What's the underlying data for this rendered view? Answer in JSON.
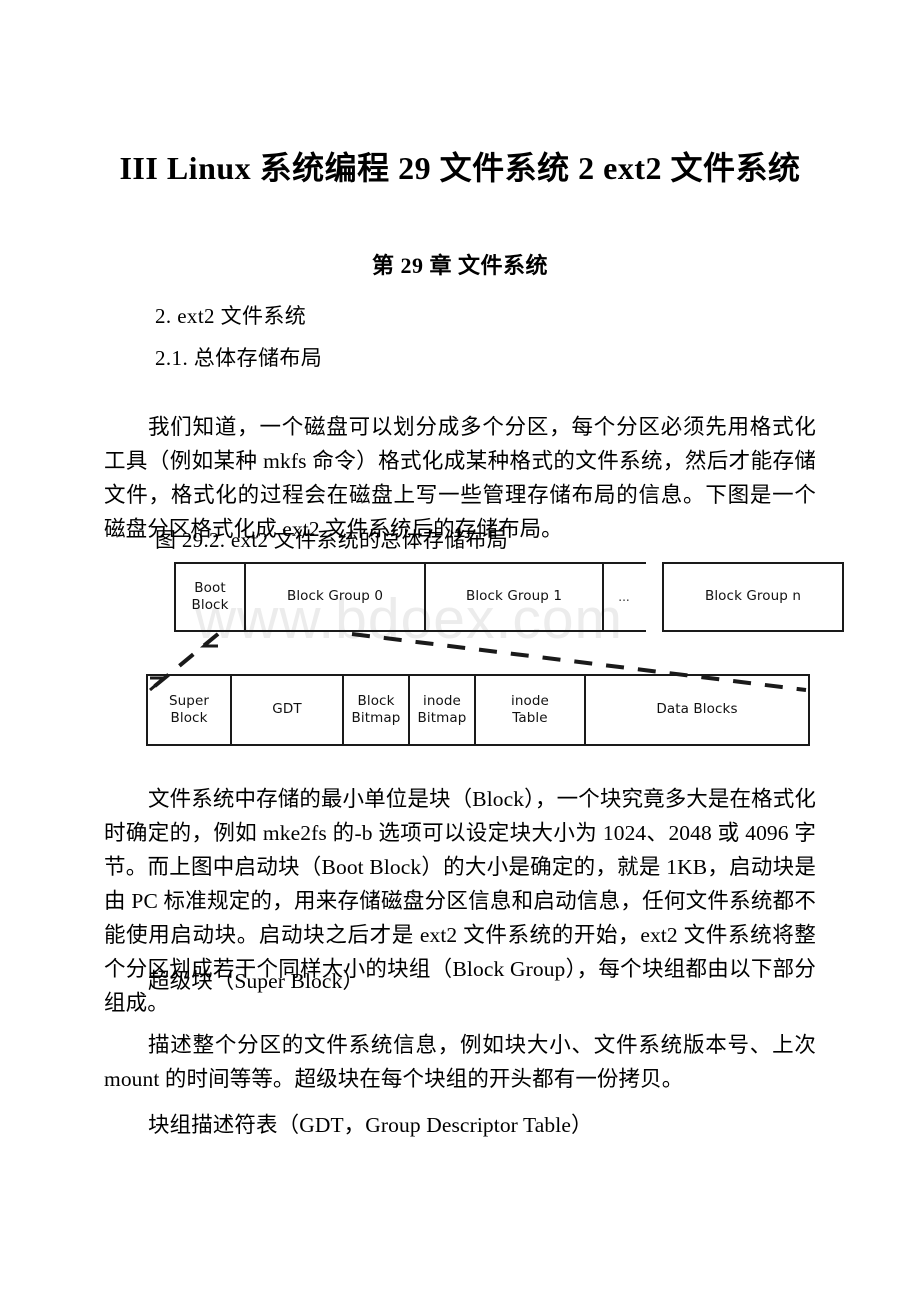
{
  "document": {
    "title": "III Linux 系统编程 29 文件系统 2 ext2 文件系统",
    "chapter_title": "第 29 章 文件系统",
    "section_1": "2. ext2 文件系统",
    "section_2": "2.1. 总体存储布局",
    "paragraph_1": "我们知道，一个磁盘可以划分成多个分区，每个分区必须先用格式化工具（例如某种 mkfs 命令）格式化成某种格式的文件系统，然后才能存储文件，格式化的过程会在磁盘上写一些管理存储布局的信息。下图是一个磁盘分区格式化成 ext2 文件系统后的存储布局。",
    "figure_caption": "图 29.2. ext2 文件系统的总体存储布局",
    "paragraph_2": "文件系统中存储的最小单位是块（Block），一个块究竟多大是在格式化时确定的，例如 mke2fs 的-b 选项可以设定块大小为 1024、2048 或 4096 字节。而上图中启动块（Boot Block）的大小是确定的，就是 1KB，启动块是由 PC 标准规定的，用来存储磁盘分区信息和启动信息，任何文件系统都不能使用启动块。启动块之后才是 ext2 文件系统的开始，ext2 文件系统将整个分区划成若干个同样大小的块组（Block Group），每个块组都由以下部分组成。",
    "subheading_1": "超级块（Super Block）",
    "paragraph_3": "描述整个分区的文件系统信息，例如块大小、文件系统版本号、上次 mount 的时间等等。超级块在每个块组的开头都有一份拷贝。",
    "subheading_2": "块组描述符表（GDT，Group Descriptor Table）",
    "watermark": "www.bdoex.com"
  },
  "figure": {
    "top_row": {
      "name": "disk-partition-layout",
      "boxes": [
        {
          "label": "Boot\nBlock",
          "label_line1": "Boot",
          "label_line2": "Block"
        },
        {
          "label": "Block Group 0"
        },
        {
          "label": "Block Group 1"
        },
        {
          "label": "Block Group n"
        }
      ],
      "ellipsis": "..."
    },
    "bottom_row": {
      "name": "block-group-layout",
      "boxes": [
        {
          "label_line1": "Super",
          "label_line2": "Block"
        },
        {
          "label_line1": "GDT",
          "label_line2": ""
        },
        {
          "label_line1": "Block",
          "label_line2": "Bitmap"
        },
        {
          "label_line1": "inode",
          "label_line2": "Bitmap"
        },
        {
          "label_line1": "inode",
          "label_line2": "Table"
        },
        {
          "label_line1": "Data Blocks",
          "label_line2": ""
        }
      ]
    }
  }
}
